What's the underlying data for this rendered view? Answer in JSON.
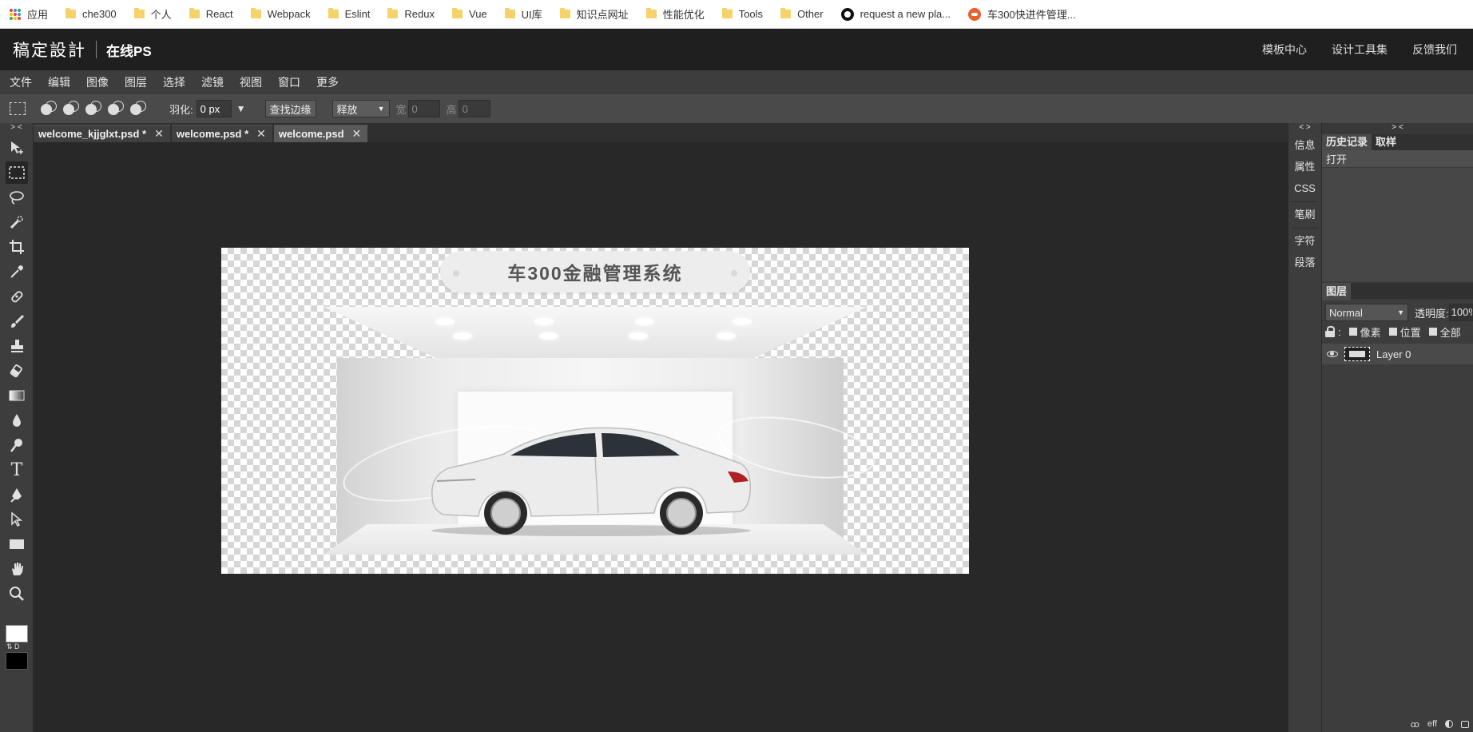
{
  "bookmarks": {
    "items": [
      {
        "label": "应用",
        "icon": "apps-icon"
      },
      {
        "label": "che300",
        "icon": "folder-icon"
      },
      {
        "label": "个人",
        "icon": "folder-icon"
      },
      {
        "label": "React",
        "icon": "folder-icon"
      },
      {
        "label": "Webpack",
        "icon": "folder-icon"
      },
      {
        "label": "Eslint",
        "icon": "folder-icon"
      },
      {
        "label": "Redux",
        "icon": "folder-icon"
      },
      {
        "label": "Vue",
        "icon": "folder-icon"
      },
      {
        "label": "UI库",
        "icon": "folder-icon"
      },
      {
        "label": "知识点网址",
        "icon": "folder-icon"
      },
      {
        "label": "性能优化",
        "icon": "folder-icon"
      },
      {
        "label": "Tools",
        "icon": "folder-icon"
      },
      {
        "label": "Other",
        "icon": "folder-icon"
      },
      {
        "label": "request a new pla...",
        "icon": "github-icon"
      },
      {
        "label": "车300快进件管理...",
        "icon": "che300-icon"
      }
    ]
  },
  "header": {
    "brand": "稿定設計",
    "subtitle": "在线PS",
    "links": [
      "模板中心",
      "设计工具集",
      "反馈我们"
    ]
  },
  "menu": [
    "文件",
    "编辑",
    "图像",
    "图层",
    "选择",
    "滤镜",
    "视图",
    "窗口",
    "更多"
  ],
  "options": {
    "feather_label": "羽化:",
    "feather_value": "0",
    "feather_unit": "px",
    "refine_edge": "查找边缘",
    "style_select": "释放",
    "width_label": "宽",
    "width_value": "0",
    "height_label": "高",
    "height_value": "0"
  },
  "tabs": [
    {
      "label": "welcome_kjjglxt.psd *",
      "active": false
    },
    {
      "label": "welcome.psd *",
      "active": false
    },
    {
      "label": "welcome.psd",
      "active": true
    }
  ],
  "canvas": {
    "title": "车300金融管理系统"
  },
  "right_icons": [
    "信息",
    "属性",
    "CSS",
    "笔刷",
    "字符",
    "段落"
  ],
  "history": {
    "tabs": [
      "历史记录",
      "取样"
    ],
    "items": [
      "打开"
    ]
  },
  "layers": {
    "tab": "图层",
    "blend_mode": "Normal",
    "opacity_label": "透明度:",
    "opacity_value": "100%",
    "lock_options": [
      "像素",
      "位置",
      "全部"
    ],
    "items": [
      {
        "name": "Layer 0",
        "visible": true
      }
    ],
    "footer": [
      "ꝏ",
      "eff"
    ]
  },
  "toolbar_collapse": "> <",
  "panel_collapse": "< >",
  "panel2_collapse": "> <",
  "swatch_labels": "⇅ D"
}
